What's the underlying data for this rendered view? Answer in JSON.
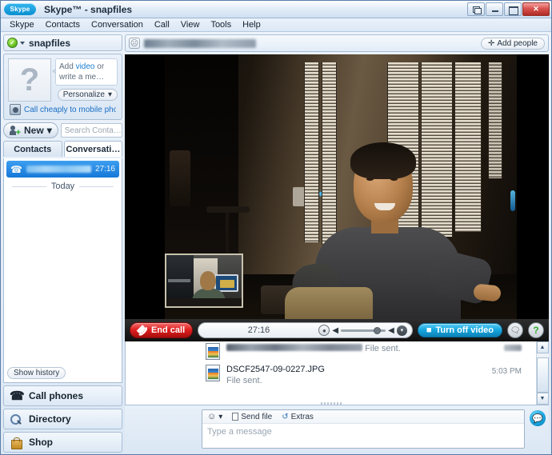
{
  "window": {
    "title": "Skype™ - snapfiles",
    "logo_text": "Skype",
    "controls": {
      "restore_label": "",
      "minimize_label": "",
      "maximize_label": "",
      "close_label": "✕"
    }
  },
  "menu": {
    "items": [
      "Skype",
      "Contacts",
      "Conversation",
      "Call",
      "View",
      "Tools",
      "Help"
    ]
  },
  "sidebar": {
    "status": {
      "name": "snapfiles",
      "presence": "online",
      "check": "✓"
    },
    "profile": {
      "avatar_glyph": "?",
      "mood_prefix": "Add ",
      "mood_link": "video",
      "mood_suffix": " or write a me…",
      "personalize_label": "Personalize",
      "personalize_caret": "▾"
    },
    "promo_link": "Call cheaply to mobile phon…",
    "new_button": {
      "label": "New",
      "caret": "▾"
    },
    "search": {
      "placeholder": "Search Conta…",
      "value": ""
    },
    "tabs": [
      {
        "label": "Contacts",
        "active": false
      },
      {
        "label": "Conversati…",
        "active": true
      }
    ],
    "conversation": {
      "icon": "phone-icon",
      "name_redacted": "",
      "duration": "27:16"
    },
    "date_separator": "Today",
    "show_history_label": "Show history",
    "footer_buttons": [
      {
        "label": "Call phones",
        "icon": "telephone-icon"
      },
      {
        "label": "Directory",
        "icon": "magnifier-icon"
      },
      {
        "label": "Shop",
        "icon": "shopping-bag-icon"
      }
    ]
  },
  "conversation_header": {
    "icon": "contact-avatar-icon",
    "title_redacted": "",
    "add_people_label": "Add people",
    "add_people_plus": "✛"
  },
  "call_toolbar": {
    "end_call_label": "End call",
    "end_call_color": "#e02020",
    "timer": "27:16",
    "mic_icon": "microphone-icon",
    "volume_low_icon": "◀",
    "volume_high_icon": "◀",
    "volume_level": 78,
    "chevron_label": "▾",
    "turn_off_video_label": "Turn off video",
    "turn_off_video_color": "#17a8e0",
    "hide_chat_icon": "chat-bubble-muted-icon",
    "help_icon": "question-mark-icon",
    "help_caret": "▾"
  },
  "video": {
    "main_stream_alt": "remote-video-stream",
    "pip_stream_alt": "local-video-preview"
  },
  "chat": {
    "messages": [
      {
        "filename_redacted": "",
        "status": "File sent.",
        "time_redacted": "",
        "clipped": true
      },
      {
        "filename": "DSCF2547-09-0227.JPG",
        "status": "File sent.",
        "time": "5:03 PM",
        "clipped": false
      }
    ],
    "scroll": {
      "up_arrow": "▲",
      "down_arrow": "▼"
    }
  },
  "compose": {
    "smiley_icon": "☺",
    "smiley_caret": "▾",
    "send_file_label": "Send file",
    "extras_label": "Extras",
    "extras_icon": "↺",
    "input_placeholder": "Type a message",
    "input_value": "",
    "send_icon": "send-message-icon"
  }
}
